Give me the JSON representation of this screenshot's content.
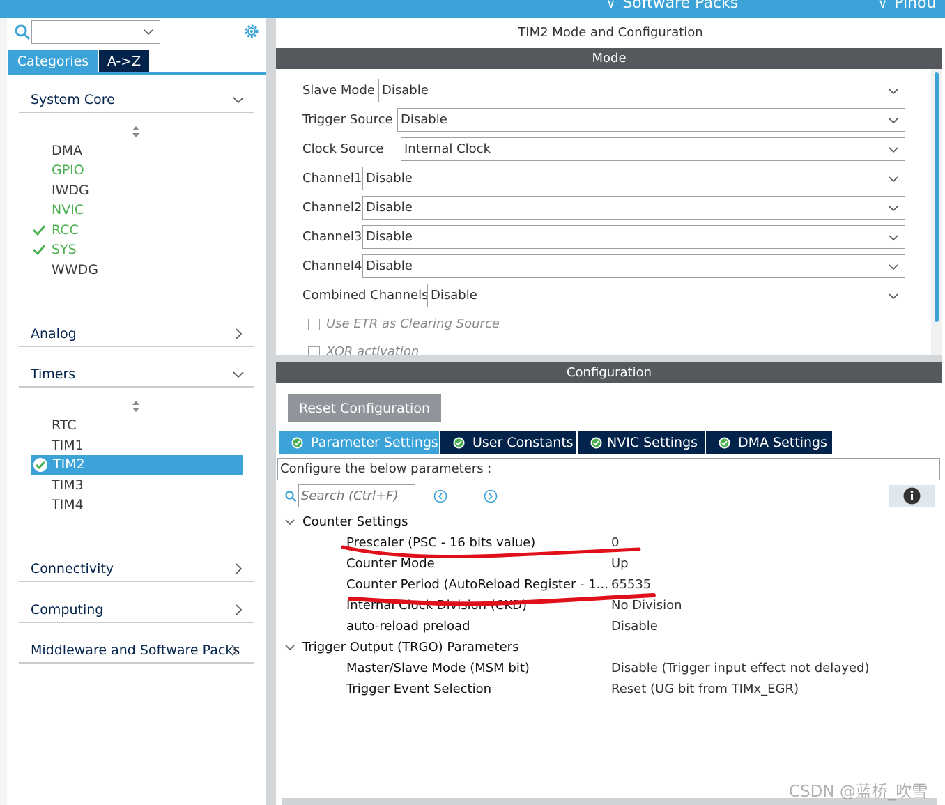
{
  "top_menu": {
    "software_packs": "Software Packs",
    "pinout": "Pinou"
  },
  "left": {
    "search_value": "",
    "tabs": {
      "categories": "Categories",
      "az": "A->Z"
    },
    "categories": {
      "system_core": "System Core",
      "analog": "Analog",
      "timers": "Timers",
      "connectivity": "Connectivity",
      "computing": "Computing",
      "middleware": "Middleware and Software Packs"
    },
    "system_core_items": [
      "DMA",
      "GPIO",
      "IWDG",
      "NVIC",
      "RCC",
      "SYS",
      "WWDG"
    ],
    "timers_items": [
      "RTC",
      "TIM1",
      "TIM2",
      "TIM3",
      "TIM4"
    ]
  },
  "title": "TIM2 Mode and Configuration",
  "mode": {
    "header": "Mode",
    "rows": [
      {
        "label": "Slave Mode",
        "value": "Disable"
      },
      {
        "label": "Trigger Source",
        "value": "Disable"
      },
      {
        "label": "Clock Source",
        "value": "Internal Clock"
      },
      {
        "label": "Channel1",
        "value": "Disable"
      },
      {
        "label": "Channel2",
        "value": "Disable"
      },
      {
        "label": "Channel3",
        "value": "Disable"
      },
      {
        "label": "Channel4",
        "value": "Disable"
      },
      {
        "label": "Combined Channels",
        "value": "Disable"
      }
    ],
    "checkboxes": [
      "Use ETR as Clearing Source",
      "XOR activation"
    ]
  },
  "config": {
    "header": "Configuration",
    "reset_label": "Reset Configuration",
    "tabs": [
      "Parameter Settings",
      "User Constants",
      "NVIC Settings",
      "DMA Settings"
    ],
    "description": "Configure the below parameters :",
    "search_placeholder": "Search (Ctrl+F)",
    "groups": [
      {
        "name": "Counter Settings",
        "params": [
          {
            "name": "Prescaler (PSC - 16 bits value)",
            "value": "0"
          },
          {
            "name": "Counter Mode",
            "value": "Up"
          },
          {
            "name": "Counter Period (AutoReload Register - 1...",
            "value": "65535"
          },
          {
            "name": "Internal Clock Division (CKD)",
            "value": "No Division"
          },
          {
            "name": "auto-reload preload",
            "value": "Disable"
          }
        ]
      },
      {
        "name": "Trigger Output (TRGO) Parameters",
        "params": [
          {
            "name": "Master/Slave Mode (MSM bit)",
            "value": "Disable (Trigger input effect not delayed)"
          },
          {
            "name": "Trigger Event Selection",
            "value": "Reset (UG bit from TIMx_EGR)"
          }
        ]
      }
    ]
  },
  "watermark": "CSDN @蓝桥_吹雪",
  "colors": {
    "accent": "#3ca3d9",
    "navy": "#03234b",
    "band": "#55595d",
    "green": "#4caf50",
    "red_mark": "#e0101a"
  }
}
